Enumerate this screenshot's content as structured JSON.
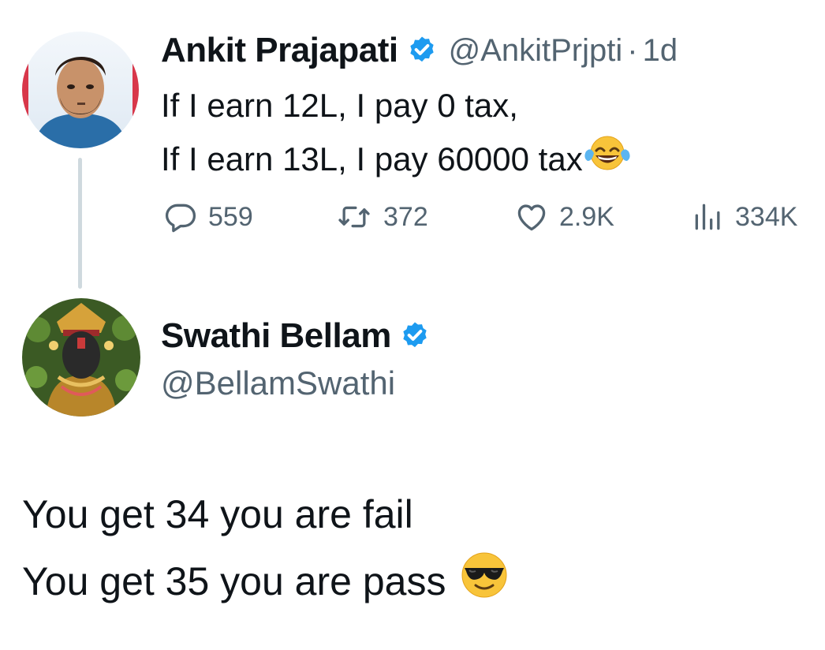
{
  "tweet": {
    "author": {
      "name": "Ankit Prajapati",
      "handle": "@AnkitPrjpti",
      "verified": true
    },
    "separator": "·",
    "time": "1d",
    "lines": [
      "If I earn 12L, I pay 0 tax,",
      "If I earn 13L, I pay 60000 tax"
    ],
    "trailing_emoji": "face-with-tears-of-joy",
    "stats": {
      "replies": "559",
      "reposts": "372",
      "likes": "2.9K",
      "views": "334K"
    }
  },
  "reply": {
    "author": {
      "name": "Swathi Bellam",
      "handle": "@BellamSwathi",
      "verified": true
    },
    "lines": [
      "You get 34 you are fail",
      "You get 35 you are pass"
    ],
    "trailing_emoji": "smiling-face-with-sunglasses"
  },
  "colors": {
    "text_primary": "#0f1419",
    "text_secondary": "#536471",
    "verified_blue": "#1d9bf0",
    "thread_line": "#cfd9de"
  }
}
